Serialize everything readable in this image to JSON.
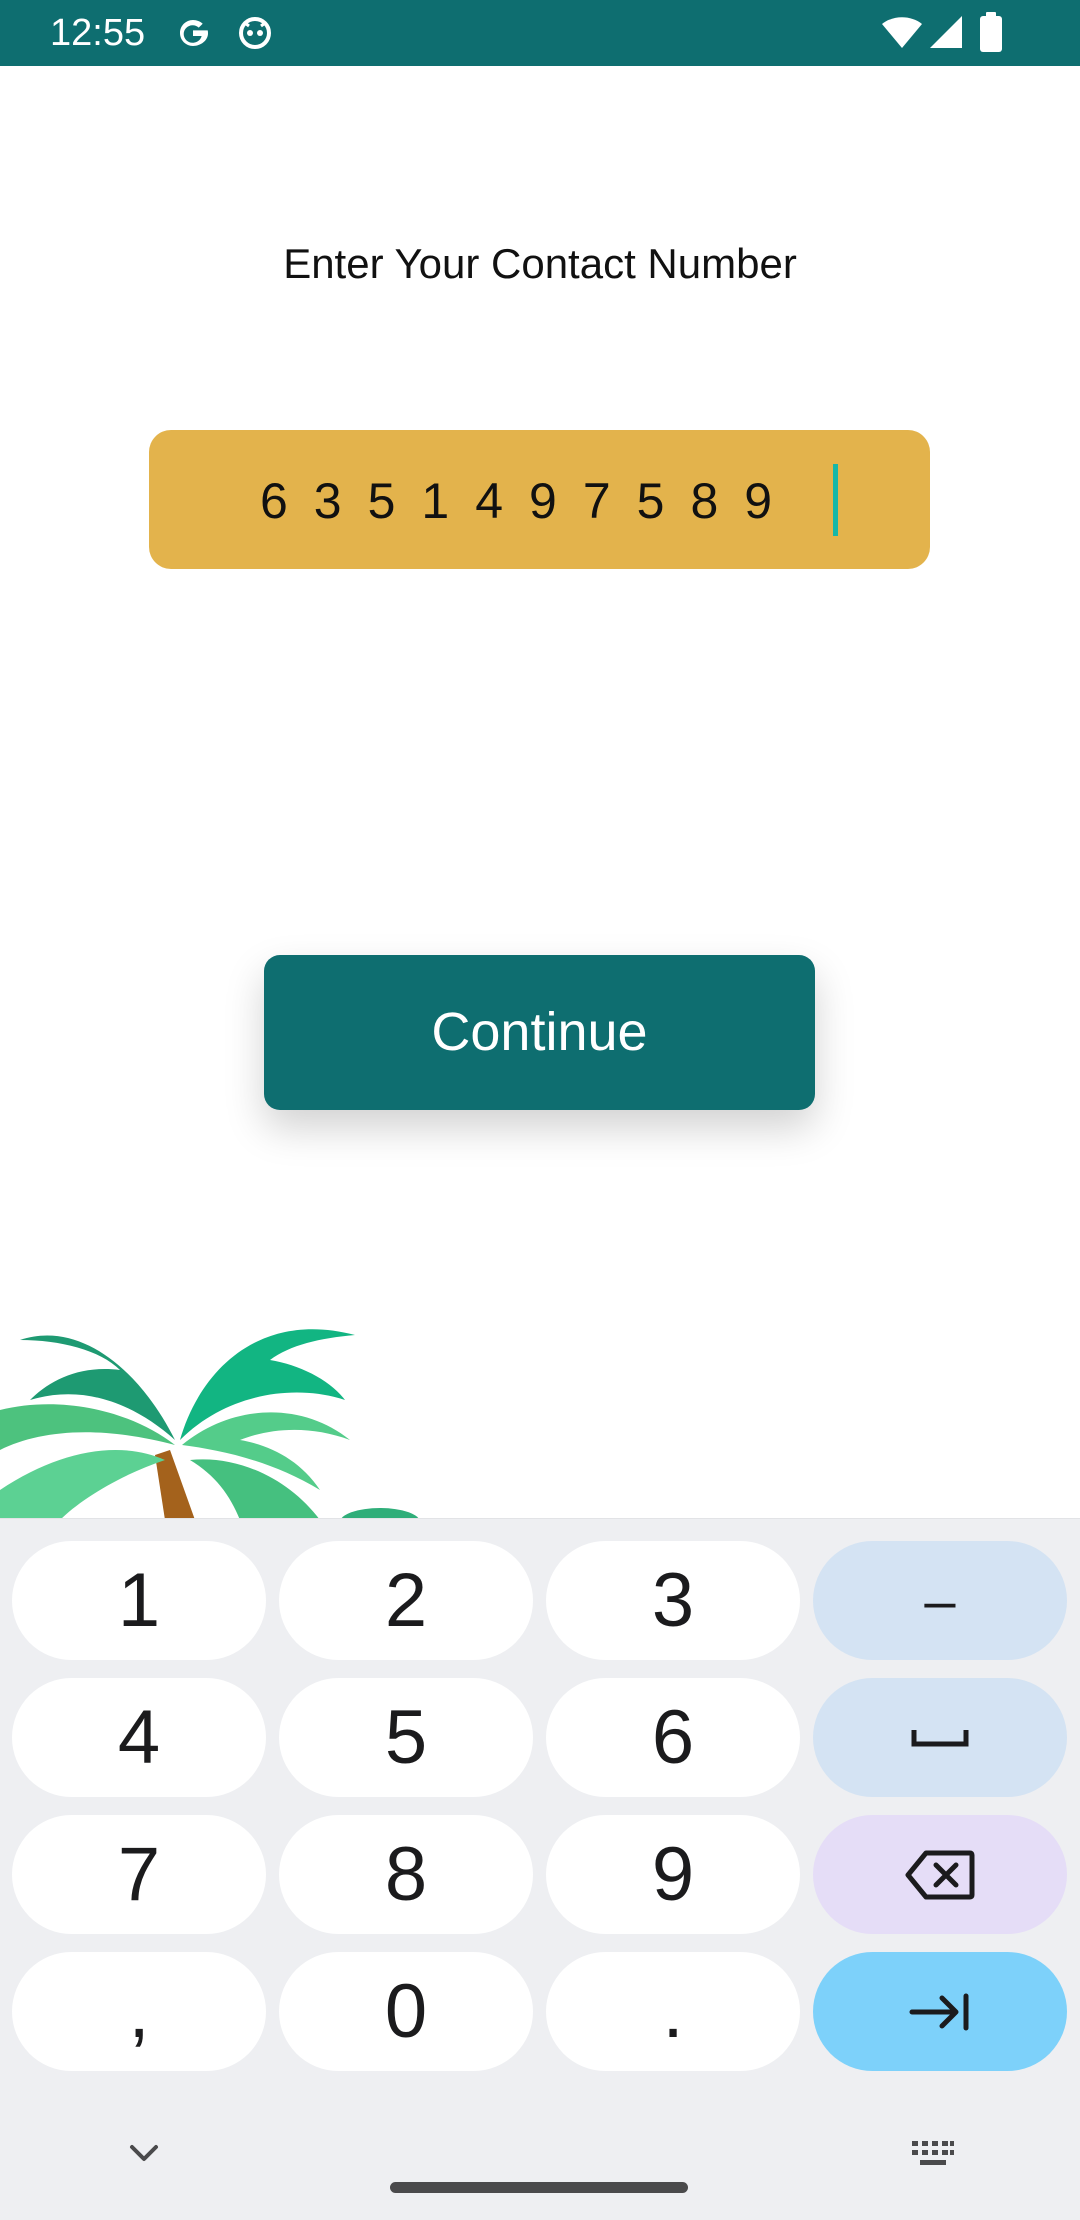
{
  "status_bar": {
    "time": "12:55",
    "left_icons": [
      "google-icon",
      "android-head-icon"
    ],
    "right_icons": [
      "wifi-icon",
      "signal-icon",
      "battery-icon"
    ],
    "background": "#0e6e70"
  },
  "screen": {
    "title": "Enter Your Contact Number",
    "phone_input": {
      "value": "6351497589",
      "background": "#e3b34c",
      "cursor_color": "#16b7a7"
    },
    "continue_button": {
      "label": "Continue",
      "background": "#0e6e70"
    },
    "decoration": "palm-tree-illustration"
  },
  "keyboard": {
    "rows": [
      [
        {
          "label": "1"
        },
        {
          "label": "2"
        },
        {
          "label": "3"
        },
        {
          "label": "–",
          "kind": "fn"
        }
      ],
      [
        {
          "label": "4"
        },
        {
          "label": "5"
        },
        {
          "label": "6"
        },
        {
          "label": "",
          "kind": "fn",
          "icon": "space-icon"
        }
      ],
      [
        {
          "label": "7"
        },
        {
          "label": "8"
        },
        {
          "label": "9"
        },
        {
          "label": "",
          "kind": "bksp",
          "icon": "backspace-icon"
        }
      ],
      [
        {
          "label": ","
        },
        {
          "label": "0"
        },
        {
          "label": "."
        },
        {
          "label": "",
          "kind": "enter",
          "icon": "tab-next-icon"
        }
      ]
    ],
    "bottom_icons": [
      "chevron-down-icon",
      "keyboard-switch-icon"
    ],
    "colors": {
      "background": "#eeeff2",
      "key": "#ffffff",
      "function_key": "#d4e3f3",
      "backspace_key": "#e5ddf7",
      "action_key": "#7dd1fa"
    }
  }
}
